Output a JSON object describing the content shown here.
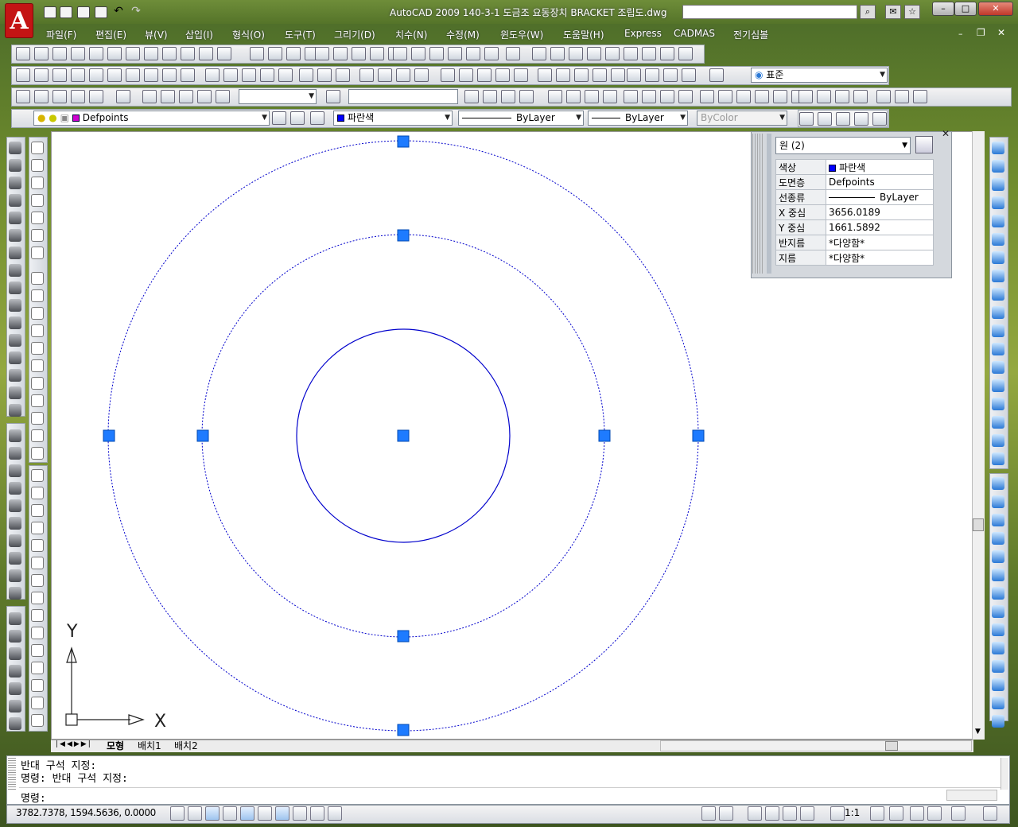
{
  "window": {
    "title": "AutoCAD 2009 140-3-1 도금조 요동장치 BRACKET 조립도.dwg",
    "logo": "A",
    "search_placeholder": ""
  },
  "menu": [
    "파일(F)",
    "편집(E)",
    "뷰(V)",
    "삽입(I)",
    "형식(O)",
    "도구(T)",
    "그리기(D)",
    "치수(N)",
    "수정(M)",
    "윈도우(W)",
    "도움말(H)",
    "Express",
    "CADMAS",
    "전기심볼"
  ],
  "toolbars": {
    "style_combo": "표준",
    "layer_combo": "Defpoints",
    "color_combo": "파란색",
    "linetype_combo": "ByLayer",
    "lineweight_combo": "ByLayer",
    "plotstyle_combo": "ByColor"
  },
  "properties": {
    "selection": "원 (2)",
    "rows": [
      {
        "key": "색상",
        "value": "파란색"
      },
      {
        "key": "도면층",
        "value": "Defpoints"
      },
      {
        "key": "선종류",
        "value": "ByLayer"
      },
      {
        "key": "X 중심",
        "value": "3656.0189"
      },
      {
        "key": "Y 중심",
        "value": "1661.5892"
      },
      {
        "key": "반지름",
        "value": "*다양함*"
      },
      {
        "key": "지름",
        "value": "*다양함*"
      }
    ]
  },
  "ucs": {
    "x": "X",
    "y": "Y"
  },
  "tabs": [
    "모형",
    "배치1",
    "배치2"
  ],
  "command": {
    "history": [
      "반대 구석 지정:",
      "명령: 반대 구석 지정:"
    ],
    "prompt": "명령:"
  },
  "status": {
    "coordinates": "3782.7378, 1594.5636, 0.0000",
    "annotation_scale": "1:1"
  },
  "colors": {
    "entity": "#0000cc",
    "grip": "#1e7bff",
    "canvas": "#ffffff"
  }
}
